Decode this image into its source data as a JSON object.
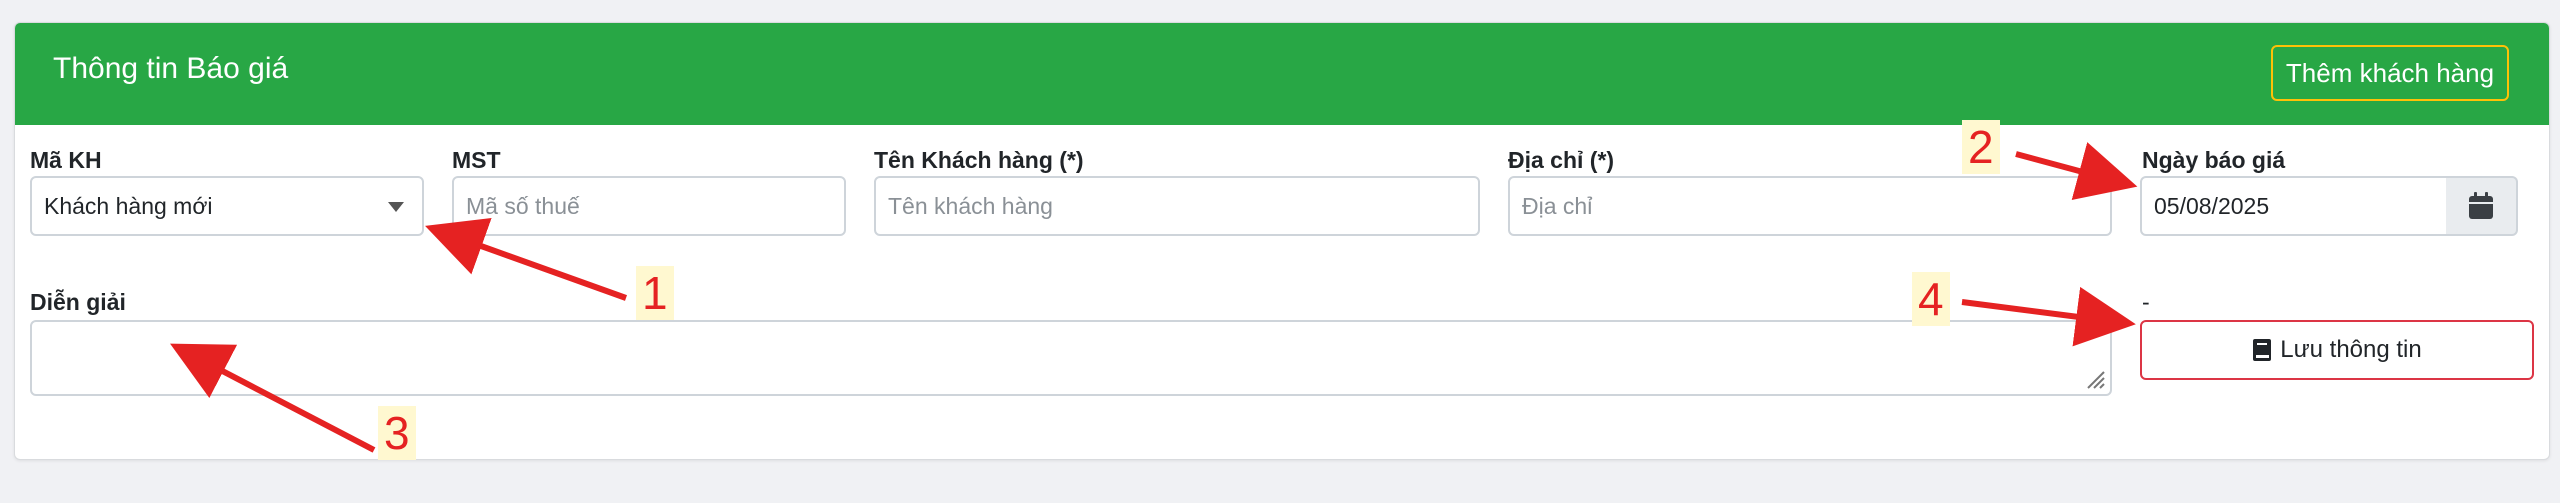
{
  "header": {
    "title": "Thông tin Báo giá",
    "add_customer_button": "Thêm khách hàng"
  },
  "form": {
    "ma_kh": {
      "label": "Mã KH",
      "value": "Khách hàng mới"
    },
    "mst": {
      "label": "MST",
      "placeholder": "Mã số thuế"
    },
    "ten_kh": {
      "label": "Tên Khách hàng (*)",
      "placeholder": "Tên khách hàng"
    },
    "dia_chi": {
      "label": "Địa chỉ (*)",
      "placeholder": "Địa chỉ"
    },
    "ngay_bao_gia": {
      "label": "Ngày báo giá",
      "value": "05/08/2025"
    },
    "dien_giai": {
      "label": "Diễn giải",
      "value": ""
    },
    "save_label_top": "-",
    "save_button": "Lưu thông tin"
  },
  "annotations": [
    "1",
    "2",
    "3",
    "4"
  ],
  "colors": {
    "header": "#28a745",
    "annotation": "#e52222",
    "save_border": "#dc3545",
    "add_border": "#ffc107"
  },
  "icons": {
    "date_picker": "calendar-icon",
    "save": "book-icon",
    "select": "caret-down-icon"
  }
}
